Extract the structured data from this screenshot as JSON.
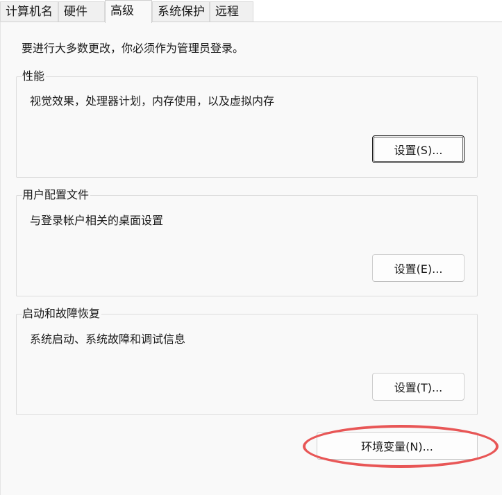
{
  "tabs": [
    {
      "label": "计算机名",
      "active": false
    },
    {
      "label": "硬件",
      "active": false
    },
    {
      "label": "高级",
      "active": true
    },
    {
      "label": "系统保护",
      "active": false
    },
    {
      "label": "远程",
      "active": false
    }
  ],
  "notice": "要进行大多数更改，你必须作为管理员登录。",
  "performance": {
    "label": "性能",
    "description": "视觉效果，处理器计划，内存使用，以及虚拟内存",
    "button": "设置(S)..."
  },
  "user_profiles": {
    "label": "用户配置文件",
    "description": "与登录帐户相关的桌面设置",
    "button": "设置(E)..."
  },
  "startup_recovery": {
    "label": "启动和故障恢复",
    "description": "系统启动、系统故障和调试信息",
    "button": "设置(T)..."
  },
  "env_button": "环境变量(N)...",
  "colors": {
    "highlight": "#e85656",
    "panel": "#f9f9f9"
  }
}
